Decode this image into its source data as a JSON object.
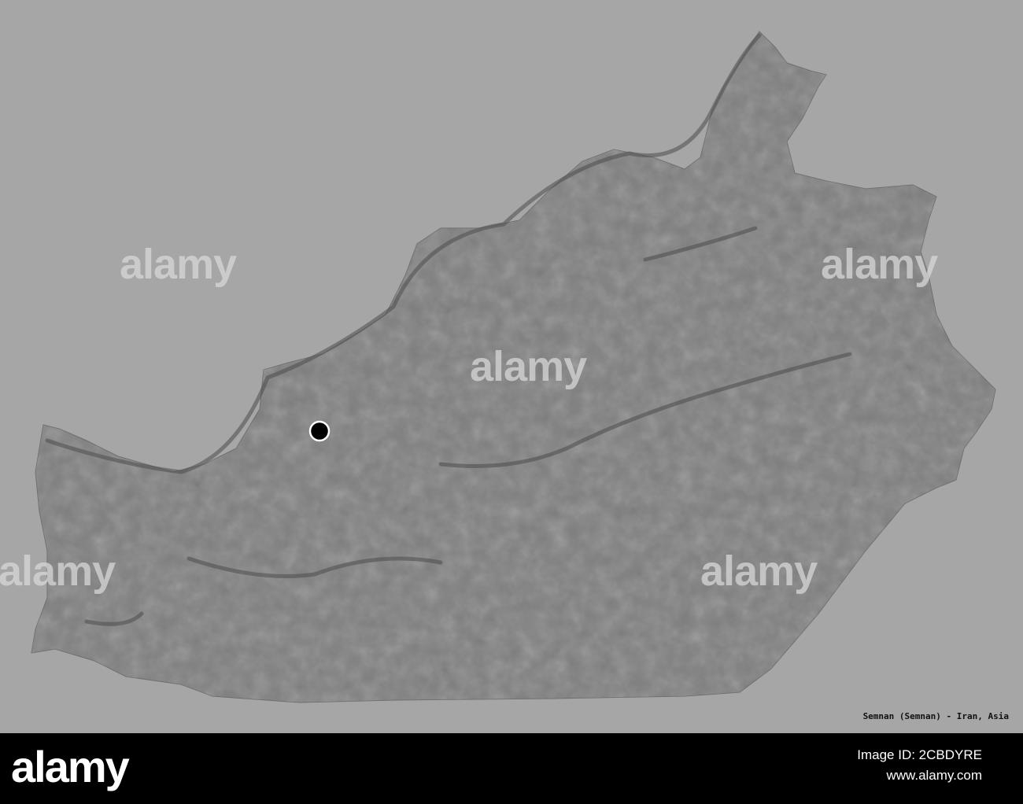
{
  "map": {
    "region_name": "Semnan (Semnan)",
    "caption": "Semnan (Semnan) - Iran, Asia",
    "colors": {
      "background": "#a6a6a6",
      "region_fill": "#7e7e7e",
      "relief_shadow": "#4a4a4a",
      "marker": "#000000",
      "marker_stroke": "#ffffff"
    }
  },
  "watermark": {
    "text": "alamy"
  },
  "banner": {
    "logo": "alamy",
    "image_id": "Image ID: 2CBDYRE",
    "url": "www.alamy.com"
  }
}
